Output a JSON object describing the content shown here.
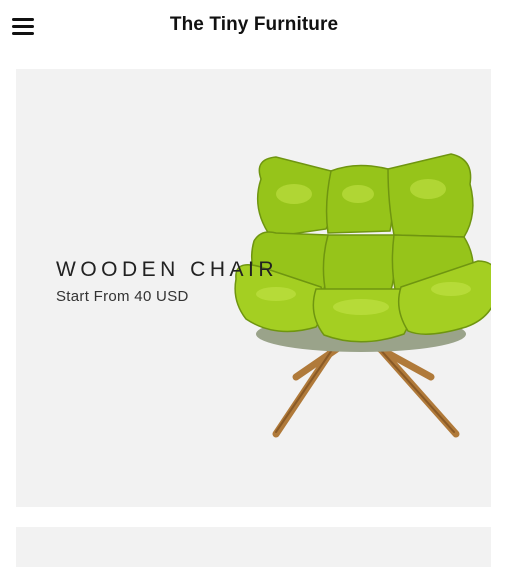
{
  "header": {
    "title": "The Tiny Furniture",
    "menu_icon": "hamburger-menu-icon"
  },
  "hero": {
    "title": "WOODEN CHAIR",
    "subtitle": "Start From 40 USD",
    "image": "green-lounge-chair",
    "background_color": "#f2f2f2"
  }
}
